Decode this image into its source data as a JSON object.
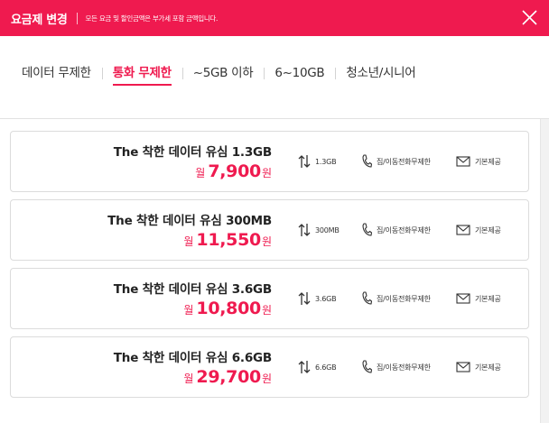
{
  "header": {
    "title": "요금제 변경",
    "note": "모든 요금 및 할인금액은 부가세 포함 금액입니다."
  },
  "tabs": [
    {
      "label": "데이터 무제한",
      "active": false
    },
    {
      "label": "통화 무제한",
      "active": true
    },
    {
      "label": "~5GB 이하",
      "active": false
    },
    {
      "label": "6~10GB",
      "active": false
    },
    {
      "label": "청소년/시니어",
      "active": false
    }
  ],
  "plans": [
    {
      "name": "The 착한 데이터 유심 1.3GB",
      "price_prefix": "월",
      "price": "7,900",
      "price_suffix": "원",
      "data": "1.3GB",
      "call": "집/이동전화무제한",
      "sms": "기본제공"
    },
    {
      "name": "The 착한 데이터 유심 300MB",
      "price_prefix": "월",
      "price": "11,550",
      "price_suffix": "원",
      "data": "300MB",
      "call": "집/이동전화무제한",
      "sms": "기본제공"
    },
    {
      "name": "The 착한 데이터 유심 3.6GB",
      "price_prefix": "월",
      "price": "10,800",
      "price_suffix": "원",
      "data": "3.6GB",
      "call": "집/이동전화무제한",
      "sms": "기본제공"
    },
    {
      "name": "The 착한 데이터 유심 6.6GB",
      "price_prefix": "월",
      "price": "29,700",
      "price_suffix": "원",
      "data": "6.6GB",
      "call": "집/이동전화무제한",
      "sms": "기본제공"
    }
  ],
  "icons": {
    "close": "close-icon",
    "data": "data-transfer-icon",
    "call": "phone-icon",
    "sms": "envelope-icon"
  },
  "colors": {
    "accent": "#ef1a4f",
    "card_border": "#dcdcdc"
  }
}
